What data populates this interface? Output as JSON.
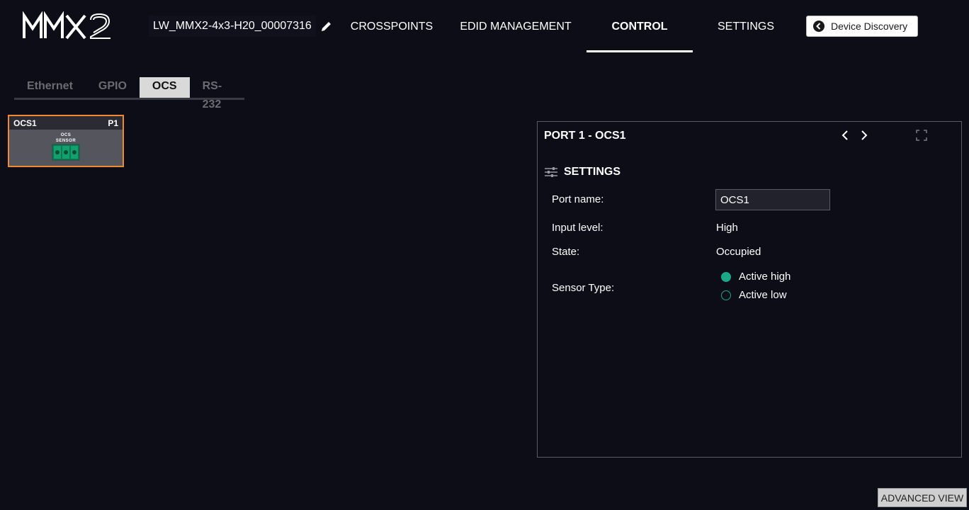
{
  "header": {
    "logo_icon": "mmx2-logo",
    "device_name": "LW_MMX2-4x3-H20_00007316",
    "edit_icon": "pencil-icon",
    "nav": [
      {
        "label": "CROSSPOINTS",
        "active": false
      },
      {
        "label": "EDID MANAGEMENT",
        "active": false
      },
      {
        "label": "CONTROL",
        "active": true
      },
      {
        "label": "SETTINGS",
        "active": false
      }
    ],
    "discovery_label": "Device Discovery",
    "discovery_icon": "back-circle-icon"
  },
  "subtabs": [
    {
      "label": "Ethernet",
      "active": false
    },
    {
      "label": "GPIO",
      "active": false
    },
    {
      "label": "OCS",
      "active": true
    },
    {
      "label": "RS-232",
      "active": false
    }
  ],
  "port_card": {
    "name": "OCS1",
    "port": "P1",
    "sensor_line1": "OCS",
    "sensor_line2": "SENSOR",
    "accent_color": "#f08a2e",
    "connector_color": "#1aa889"
  },
  "panel": {
    "title": "PORT 1 - OCS1",
    "prev_icon": "chevron-left-icon",
    "next_icon": "chevron-right-icon",
    "expand_icon": "expand-icon",
    "section_icon": "sliders-icon",
    "section_title": "SETTINGS",
    "port_name_label": "Port name:",
    "port_name_value": "OCS1",
    "input_level_label": "Input level:",
    "input_level_value": "High",
    "state_label": "State:",
    "state_value": "Occupied",
    "sensor_type_label": "Sensor Type:",
    "sensor_type_options": [
      {
        "label": "Active high",
        "selected": true
      },
      {
        "label": "Active low",
        "selected": false
      }
    ],
    "radio_color": "#1aa889"
  },
  "advanced_view_label": "ADVANCED VIEW"
}
